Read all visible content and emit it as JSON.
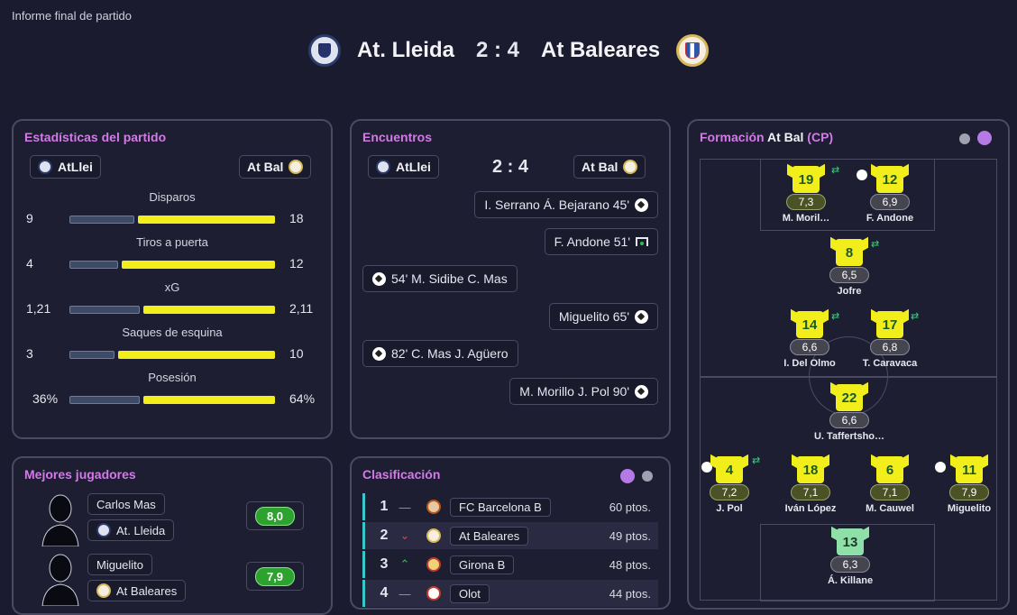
{
  "header": {
    "title": "Informe final de partido",
    "home": "At. Lleida",
    "away": "At Baleares",
    "score": "2 : 4"
  },
  "stats": {
    "title": "Estadísticas del partido",
    "home_chip": "AtLlei",
    "away_chip": "At Bal",
    "rows": [
      {
        "label": "Disparos",
        "home": "9",
        "away": "18",
        "home_share": 0.33
      },
      {
        "label": "Tiros a puerta",
        "home": "4",
        "away": "12",
        "home_share": 0.25
      },
      {
        "label": "xG",
        "home": "1,21",
        "away": "2,11",
        "home_share": 0.36
      },
      {
        "label": "Saques de esquina",
        "home": "3",
        "away": "10",
        "home_share": 0.23
      },
      {
        "label": "Posesión",
        "home": "36%",
        "away": "64%",
        "home_share": 0.36
      }
    ]
  },
  "encounters": {
    "title": "Encuentros",
    "home_chip": "AtLlei",
    "away_chip": "At Bal",
    "score": "2 : 4",
    "events": [
      {
        "text": "I. Serrano  Á. Bejarano  45'",
        "side": "away",
        "icon": "ball-icon"
      },
      {
        "text": "F. Andone  51'",
        "side": "away",
        "icon": "goal-post-icon"
      },
      {
        "text": "54'  M. Sidibe  C. Mas",
        "side": "home",
        "icon": "ball-icon"
      },
      {
        "text": "Miguelito  65'",
        "side": "away",
        "icon": "ball-icon"
      },
      {
        "text": "82'  C. Mas  J. Agüero",
        "side": "home",
        "icon": "ball-icon"
      },
      {
        "text": "M. Morillo  J. Pol  90'",
        "side": "away",
        "icon": "ball-icon"
      }
    ]
  },
  "best_players": {
    "title": "Mejores jugadores",
    "players": [
      {
        "name": "Carlos Mas",
        "team": "At. Lleida",
        "rating": "8,0"
      },
      {
        "name": "Miguelito",
        "team": "At Baleares",
        "rating": "7,9"
      }
    ]
  },
  "standings": {
    "title": "Clasificación",
    "rows": [
      {
        "pos": "1",
        "trend": "—",
        "team": "FC Barcelona B",
        "pts": "60 ptos."
      },
      {
        "pos": "2",
        "trend": "⌄",
        "team": "At Baleares",
        "pts": "49 ptos."
      },
      {
        "pos": "3",
        "trend": "⌃",
        "team": "Girona B",
        "pts": "48 ptos."
      },
      {
        "pos": "4",
        "trend": "—",
        "team": "Olot",
        "pts": "44 ptos."
      }
    ],
    "colors": {
      "up": "#2fc14d",
      "down": "#e04545",
      "same": "#9a9aaa"
    }
  },
  "formation": {
    "title_prefix": "Formación",
    "team": "At Bal",
    "shape": "(CP)",
    "players": [
      {
        "num": "19",
        "rating": "7,3",
        "name": "M. Moril…"
      },
      {
        "num": "12",
        "rating": "6,9",
        "name": "F. Andone"
      },
      {
        "num": "8",
        "rating": "6,5",
        "name": "Jofre"
      },
      {
        "num": "14",
        "rating": "6,6",
        "name": "I. Del Olmo"
      },
      {
        "num": "17",
        "rating": "6,8",
        "name": "T. Caravaca"
      },
      {
        "num": "22",
        "rating": "6,6",
        "name": "U. Taffertsho…"
      },
      {
        "num": "4",
        "rating": "7,2",
        "name": "J. Pol"
      },
      {
        "num": "18",
        "rating": "7,1",
        "name": "Iván López"
      },
      {
        "num": "6",
        "rating": "7,1",
        "name": "M. Cauwel"
      },
      {
        "num": "11",
        "rating": "7,9",
        "name": "Miguelito"
      },
      {
        "num": "13",
        "rating": "6,3",
        "name": "Á. Killane"
      }
    ]
  }
}
